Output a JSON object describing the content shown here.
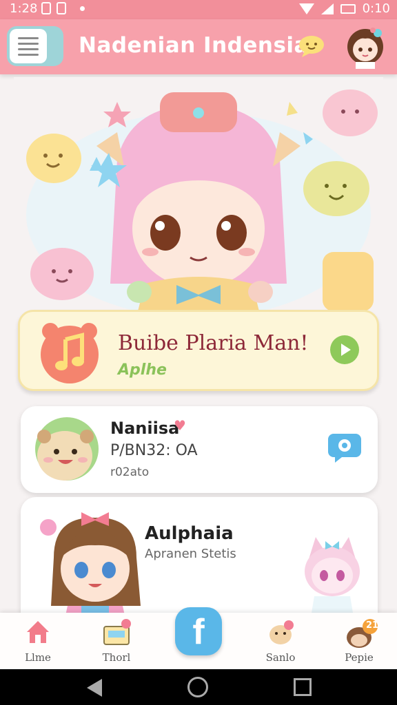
{
  "status": {
    "time": "1:28",
    "clock_right": "0:10"
  },
  "header": {
    "title": "Nadenian Indensia",
    "menu_icon": "hamburger-icon",
    "chat_icon": "chat-bubble-icon",
    "accent": "#f7a1ab"
  },
  "featured": {
    "title": "Buibe Plaria Man!",
    "subtitle": "Aplhe",
    "icon": "music-note-icon"
  },
  "cards": [
    {
      "name": "Naniisa",
      "line2": "P/BN32: OA",
      "line3": "r02ato",
      "action_icon": "settings-gear-icon"
    },
    {
      "name": "Aulphaia",
      "subtitle": "Apranen Stetis"
    }
  ],
  "nav": {
    "items": [
      {
        "label": "Llme",
        "icon": "home-icon"
      },
      {
        "label": "Thorl",
        "icon": "inbox-icon"
      },
      {
        "label": "",
        "icon": "facebook-icon",
        "glyph": "f"
      },
      {
        "label": "Sanlo",
        "icon": "character-icon"
      },
      {
        "label": "Pepie",
        "icon": "profile-icon",
        "badge": "21"
      }
    ]
  }
}
